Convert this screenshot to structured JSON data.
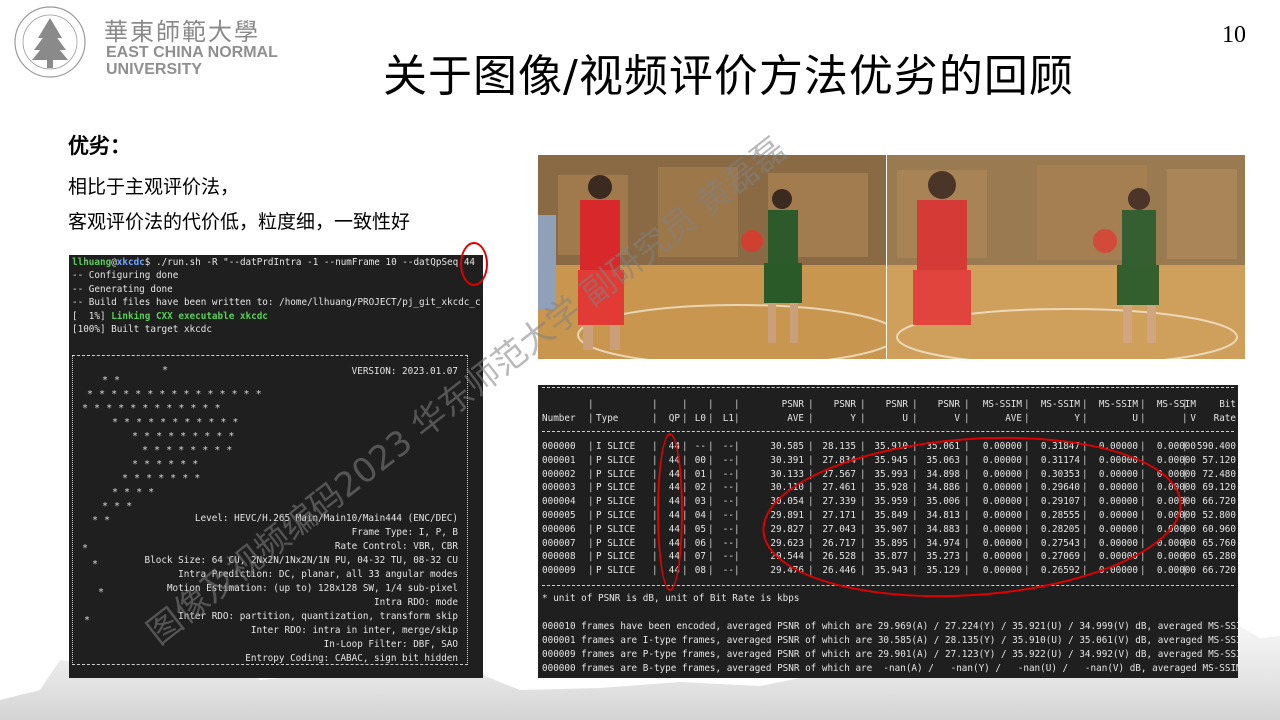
{
  "logo": {
    "cn": "華東師範大學",
    "en_line1": "EAST CHINA NORMAL",
    "en_line2": "UNIVERSITY",
    "ring_text": "EAST CHINA NORMAL UNIVERSITY"
  },
  "page_number": "10",
  "title": "关于图像/视频评价方法优劣的回顾",
  "section": {
    "heading": "优劣：",
    "lines": [
      "相比于主观评价法，",
      "客观评价法的代价低，粒度细，一致性好"
    ]
  },
  "terminal": {
    "prompt_user": "llhuang",
    "prompt_at": "@",
    "prompt_host": "xkcdc",
    "prompt_rest": "$ ./run.sh -R \"--datPrdIntra -1 --numFrame 10 --datQpSeq 44",
    "lines": [
      "-- Configuring done",
      "-- Generating done",
      "-- Build files have been written to: /home/llhuang/PROJECT/pj_git_xkcdc_c",
      "[  1%] ",
      "[100%] Built target xkcdc"
    ],
    "linking_text": "Linking CXX executable xkcdc",
    "version": "VERSION: 2023.01.07",
    "info": [
      "Level: HEVC/H.265 Main/Main10/Main444 (ENC/DEC)",
      "Frame Type: I, P, B",
      "Rate Control: VBR, CBR",
      "Block Size: 64 CU, 2Nx2N/1Nx2N/1N PU, 04-32 TU, 08-32 CU",
      "Intra Prediction: DC, planar, all 33 angular modes",
      "Motion Estimation: (up to) 128x128 SW, 1/4 sub-pixel",
      "Intra RDO: mode",
      "Inter RDO: partition, quantization, transform skip",
      "Inter RDO: intra in inter, merge/skip",
      "In-Loop Filter: DBF, SAO",
      "Entropy Coding: CABAC, sign bit hidden"
    ]
  },
  "table": {
    "headers_top": [
      "",
      "",
      "",
      "",
      "",
      "PSNR",
      "PSNR",
      "PSNR",
      "PSNR",
      "MS-SSIM",
      "MS-SSIM",
      "MS-SSIM",
      "MS-SSIM",
      "Bit"
    ],
    "headers_bottom": [
      "Number",
      "Type",
      "QP",
      "L0",
      "L1",
      "AVE",
      "Y",
      "U",
      "V",
      "AVE",
      "Y",
      "U",
      "V",
      "Rate"
    ],
    "rows": [
      [
        "000000",
        "I SLICE",
        "44",
        "--",
        "--",
        "30.585",
        "28.135",
        "35.910",
        "35.061",
        "0.00000",
        "0.31847",
        "0.00000",
        "0.00000",
        "590.400"
      ],
      [
        "000001",
        "P SLICE",
        "44",
        "00",
        "--",
        "30.391",
        "27.834",
        "35.945",
        "35.063",
        "0.00000",
        "0.31174",
        "0.00000",
        "0.00000",
        "57.120"
      ],
      [
        "000002",
        "P SLICE",
        "44",
        "01",
        "--",
        "30.133",
        "27.567",
        "35.993",
        "34.898",
        "0.00000",
        "0.30353",
        "0.00000",
        "0.00000",
        "72.480"
      ],
      [
        "000003",
        "P SLICE",
        "44",
        "02",
        "--",
        "30.110",
        "27.461",
        "35.928",
        "34.886",
        "0.00000",
        "0.29640",
        "0.00000",
        "0.00000",
        "69.120"
      ],
      [
        "000004",
        "P SLICE",
        "44",
        "03",
        "--",
        "30.054",
        "27.339",
        "35.959",
        "35.006",
        "0.00000",
        "0.29107",
        "0.00000",
        "0.00000",
        "66.720"
      ],
      [
        "000005",
        "P SLICE",
        "44",
        "04",
        "--",
        "29.891",
        "27.171",
        "35.849",
        "34.813",
        "0.00000",
        "0.28555",
        "0.00000",
        "0.00000",
        "52.800"
      ],
      [
        "000006",
        "P SLICE",
        "44",
        "05",
        "--",
        "29.827",
        "27.043",
        "35.907",
        "34.883",
        "0.00000",
        "0.28205",
        "0.00000",
        "0.00000",
        "60.960"
      ],
      [
        "000007",
        "P SLICE",
        "44",
        "06",
        "--",
        "29.623",
        "26.717",
        "35.895",
        "34.974",
        "0.00000",
        "0.27543",
        "0.00000",
        "0.00000",
        "65.760"
      ],
      [
        "000008",
        "P SLICE",
        "44",
        "07",
        "--",
        "29.544",
        "26.528",
        "35.877",
        "35.273",
        "0.00000",
        "0.27069",
        "0.00000",
        "0.00000",
        "65.280"
      ],
      [
        "000009",
        "P SLICE",
        "44",
        "08",
        "--",
        "29.476",
        "26.446",
        "35.943",
        "35.129",
        "0.00000",
        "0.26592",
        "0.00000",
        "0.00000",
        "66.720"
      ]
    ],
    "note": "* unit of PSNR is dB, unit of Bit Rate is kbps",
    "summary": [
      "000010 frames have been encoded, averaged PSNR of which are 29.969(A) / 27.224(Y) / 35.921(U) / 34.999(V) dB, averaged MS-SSIM",
      "000001 frames are I-type frames, averaged PSNR of which are 30.585(A) / 28.135(Y) / 35.910(U) / 35.061(V) dB, averaged MS-SSIM",
      "000009 frames are P-type frames, averaged PSNR of which are 29.901(A) / 27.123(Y) / 35.922(U) / 34.992(V) dB, averaged MS-SSIM",
      "000000 frames are B-type frames, averaged PSNR of which are  -nan(A) /   -nan(Y) /   -nan(U) /   -nan(V) dB, averaged MS-SSIM"
    ]
  },
  "watermark": "图像及视频编码2023 华东师范大学 副研究员 黄磊磊",
  "colors": {
    "annotation_red": "#e00000",
    "terminal_bg": "#1f1f1f",
    "prompt_green": "#5fc95f",
    "prompt_blue": "#6fa8ff"
  }
}
